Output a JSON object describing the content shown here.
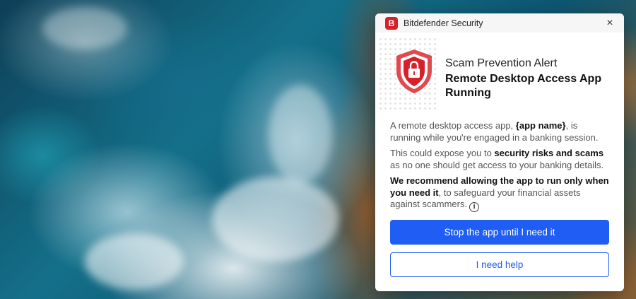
{
  "notification": {
    "app_title": "Bitdefender Security",
    "logo_letter": "B",
    "close_glyph": "×",
    "alert_label": "Scam Prevention Alert",
    "alert_heading": "Remote Desktop Access App Running",
    "paragraph1": {
      "pre": "A remote desktop access app, ",
      "app_name": "{app name}",
      "post": ", is running while you're engaged in a banking session."
    },
    "paragraph2": {
      "pre": "This could expose you to ",
      "bold": "security risks and scams",
      "post": " as no one should get access to your banking details."
    },
    "paragraph3": {
      "bold": "We recommend allowing the app to run only when you need it",
      "post": ", to safeguard your financial assets against scammers."
    },
    "info_glyph": "i",
    "primary_button": "Stop the app until I need it",
    "secondary_button": "I need help"
  },
  "colors": {
    "brand_red": "#d6202a",
    "accent_blue": "#1f5df4"
  },
  "icons": {
    "shield": "shield-lock-icon",
    "close": "close-icon",
    "info": "info-icon"
  }
}
